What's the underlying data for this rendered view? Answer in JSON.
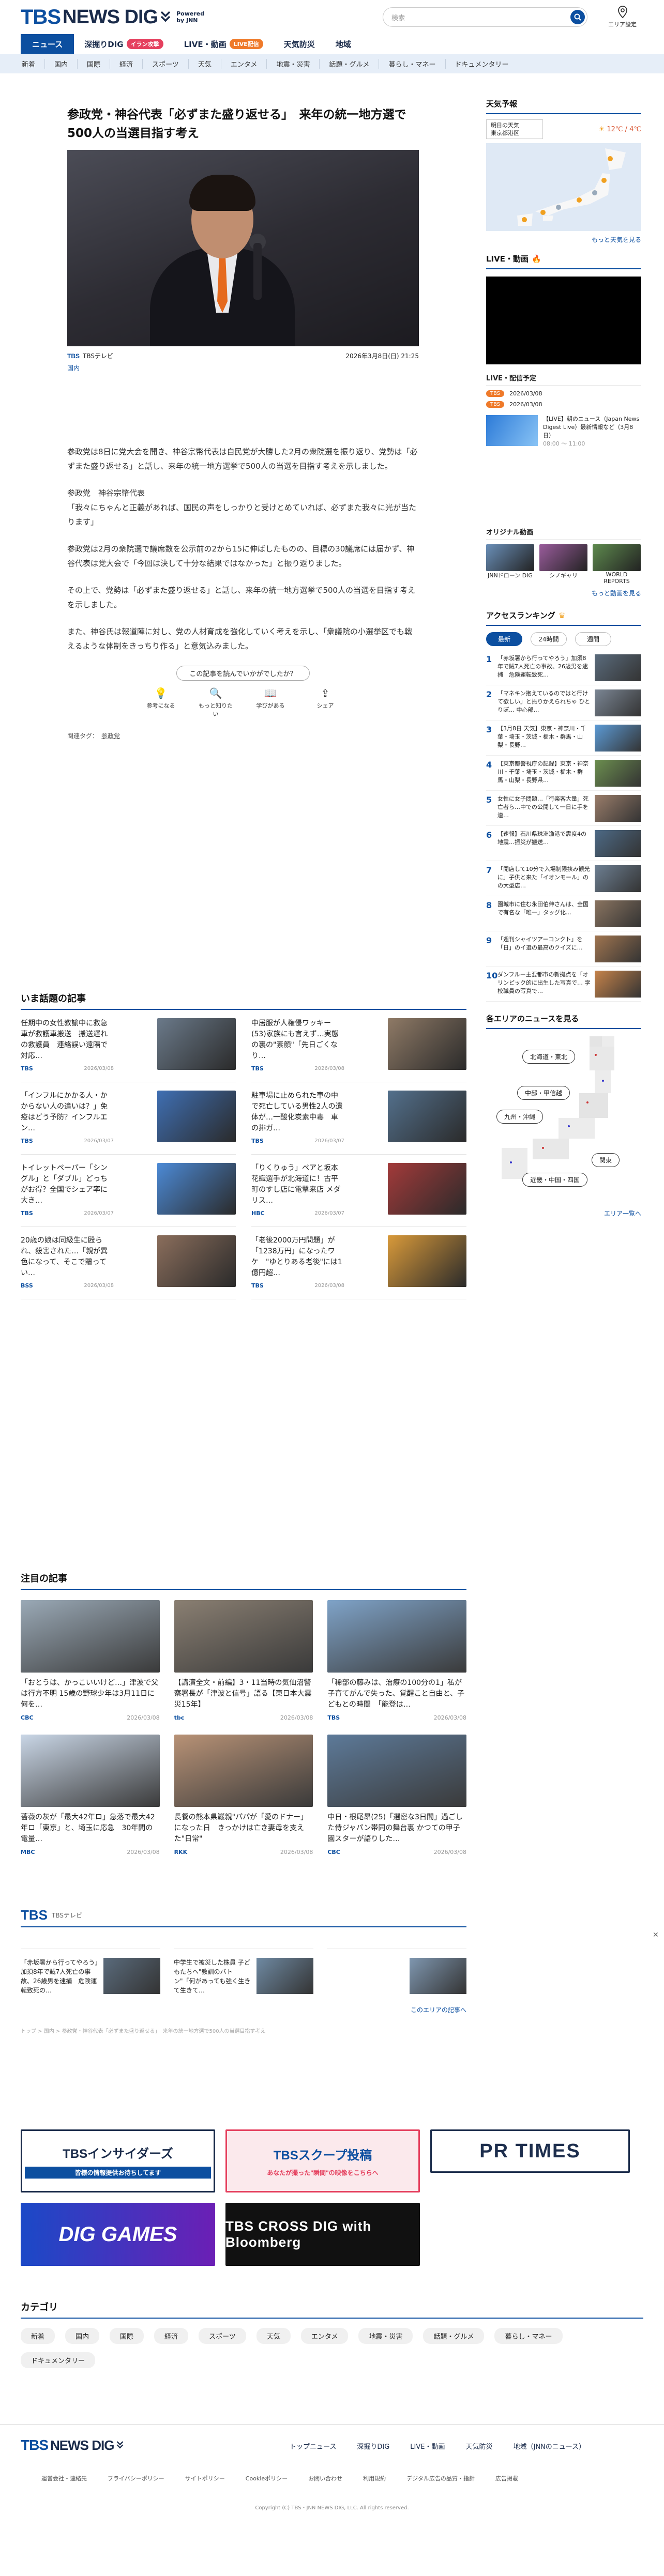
{
  "header": {
    "logo_tbs": "TBS",
    "logo_nd": "NEWS DIG",
    "powered": "Powered",
    "by": "by JNN",
    "search_placeholder": "検索",
    "area_label": "エリア設定"
  },
  "mainnav": [
    {
      "label": "ニュース",
      "active": true
    },
    {
      "label": "深掘りDIG",
      "badge": "イラン攻撃",
      "badge_color": "#e5405e"
    },
    {
      "label": "LIVE・動画",
      "badge": "LIVE配信",
      "badge_color": "#ef7a2a"
    },
    {
      "label": "天気防災"
    },
    {
      "label": "地域"
    }
  ],
  "subnav": [
    "新着",
    "国内",
    "国際",
    "経済",
    "スポーツ",
    "天気",
    "エンタメ",
    "地震・災害",
    "話題・グルメ",
    "暮らし・マネー",
    "ドキュメンタリー"
  ],
  "article": {
    "title": "参政党・神谷代表「必ずまた盛り返せる」　来年の統一地方選で500人の当選目指す考え",
    "source": "TBSテレビ",
    "date": "2026年3月8日(日) 21:25",
    "category": "国内",
    "paragraphs": [
      "参政党は8日に党大会を開き、神谷宗幣代表は自民党が大勝した2月の衆院選を振り返り、党勢は「必ずまた盛り返せる」と話し、来年の統一地方選挙で500人の当選を目指す考えを示しました。",
      "参政党　神谷宗幣代表\n「我々にちゃんと正義があれば、国民の声をしっかりと受けとめていれば、必ずまた我々に光が当たります」",
      "参政党は2月の衆院選で議席数を公示前の2から15に伸ばしたものの、目標の30議席には届かず、神谷代表は党大会で「今回は決して十分な結果ではなかった」と振り返りました。",
      "その上で、党勢は「必ずまた盛り返せる」と話し、来年の統一地方選挙で500人の当選を目指す考えを示しました。",
      "また、神谷氏は報道陣に対し、党の人材育成を強化していく考えを示し、「衆議院の小選挙区でも戦えるような体制をきっちり作る」と意気込みました。"
    ],
    "feedback_prompt": "この記事を読んでいかがでしたか？",
    "feedback": [
      "参考になる",
      "もっと知りたい",
      "学びがある",
      "シェア"
    ],
    "tags_label": "関連タグ：",
    "tag": "参政党"
  },
  "trending": {
    "heading": "いま話題の記事",
    "items": [
      {
        "text": "任期中の女性教諭中に救急車が救護車搬送　搬送遅れの救護員　連絡誤い遠隔で対応…",
        "src": "TBS",
        "date": "2026/03/08",
        "color": "#6b7a8a"
      },
      {
        "text": "中居服が人権侵ワッキー(53)家族にも言えず…実態の裏の\"素顔\"「先日ごくなり…",
        "src": "TBS",
        "date": "2026/03/08",
        "color": "#8f7a66"
      },
      {
        "text": "「インフルにかかる人・かからない人の違いは？」免疫はどう予防？インフルエン…",
        "src": "TBS",
        "date": "2026/03/07",
        "color": "#3f6fb3"
      },
      {
        "text": "駐車場に止められた車の中で死亡している男性2人の遺体が…一酸化炭素中毒　車の排ガ…",
        "src": "TBS",
        "date": "2026/03/07",
        "color": "#53708c"
      },
      {
        "text": "トイレットペーパー「シングル」と「ダブル」どっちがお得？全国でシェア率に大き…",
        "src": "TBS",
        "date": "2026/03/07",
        "color": "#4c8ad6"
      },
      {
        "text": "「りくりゅう」ペアと坂本花織選手が北海道に！古平町のすし店に電撃来店 メダリス…",
        "src": "HBC",
        "date": "2026/03/07",
        "color": "#a33a3a"
      },
      {
        "text": "20歳の娘は同級生に殴られ、殺害された…「親が異色になって、そこで贈ってい…",
        "src": "BSS",
        "date": "2026/03/08",
        "color": "#8b6e5c"
      },
      {
        "text": "「老後2000万円問題」が「1238万円」になったワケ　\"ゆとりある老後\"には1億円超…",
        "src": "TBS",
        "date": "2026/03/08",
        "color": "#d99a3a"
      }
    ]
  },
  "featured": {
    "heading": "注目の記事",
    "items": [
      {
        "text": "「おとうは、かっこいいけど…」津波で父は行方不明 15歳の野球少年は3月11日に何を…",
        "src": "CBC",
        "date": "2026/03/08",
        "color": "#9aa9b6"
      },
      {
        "text": "【講演全文・前編】3・11当時の気仙沼警察署長が「津波と信号」語る【東日本大震災15年】",
        "src": "tbc",
        "date": "2026/03/08",
        "color": "#8a7f72"
      },
      {
        "text": "「稀部の藤みは、治療の100分の1」私が子育てがんで失った、覚醒こと自由と、子どもとの時間　「能登は…",
        "src": "TBS",
        "date": "2026/03/08",
        "color": "#7fa3c8"
      },
      {
        "text": "薔薇の灰が「最大42年ロ」急落で最大42年ロ「東京」と、埼玉に応急　30年間の電量…",
        "src": "MBC",
        "date": "2026/03/08",
        "color": "#c9d6e6"
      },
      {
        "text": "長餐の熊本県巖親\"パパが「愛のドナー」になった日　きっかけは亡き妻母を支えた\"日常\"",
        "src": "RKK",
        "date": "2026/03/08",
        "color": "#b89276"
      },
      {
        "text": "中日・根尾昂(25)「選密な3日間」過ごした侍ジャパン帯同の舞台裏 かつての甲子園スターが語りした…",
        "src": "CBC",
        "date": "2026/03/08",
        "color": "#5d7a99"
      }
    ]
  },
  "tbs_block": {
    "logo": "TBS",
    "name": "TBSテレビ",
    "items": [
      {
        "text": "「赤坂署から行ってやろう」加須8年で賊7人死亡の事故、26歳男を逮捕　危険運転致死の…",
        "color": "#5a6b7c"
      },
      {
        "text": "中学生で被災した株員 子どもたちへ\"教訓のバトン\"「何があっても強く生きて生きて…",
        "color": "#6f8aa3"
      },
      {
        "text": "",
        "color": "#7f97b0"
      }
    ],
    "more": "このエリアの記事へ"
  },
  "breadcrumb": "トップ > 国内 > 参政党・神谷代表「必ずまた盛り返せる」　来年の統一地方選で500人の当選目指す考え",
  "ads": [
    "TBSインサイダーズ",
    "TBSスクープ投稿",
    "PR TIMES",
    "DIG GAMES",
    "TBS CROSS DIG with Bloomberg"
  ],
  "ads_sub": [
    "皆様の情報提供お待ちしてます",
    "あなたが撮った\"瞬間\"の映像をこちらへ"
  ],
  "categories": {
    "heading": "カテゴリ",
    "items": [
      "新着",
      "国内",
      "国際",
      "経済",
      "スポーツ",
      "天気",
      "エンタメ",
      "地震・災害",
      "話題・グルメ",
      "暮らし・マネー",
      "ドキュメンタリー"
    ]
  },
  "side": {
    "weather_h": "天気予報",
    "weather_sel1": "明日の天気",
    "weather_sel2": "東京都港区",
    "weather_temp": "12℃ / 4℃",
    "weather_more": "もっと天気を見る",
    "live_h": "LIVE・動画",
    "sched_h": "LIVE・配信予定",
    "sched": [
      {
        "pill": "TBS",
        "text": "2026/03/08"
      },
      {
        "pill": "TBS",
        "text": "2026/03/08"
      }
    ],
    "live_card": "【LIVE】朝のニュース（Japan News Digest Live）最新情報など（3月8日）",
    "live_card_time": "08:00 〜 11:00",
    "orig_h": "オリジナル動画",
    "origs": [
      {
        "label": "JNNドローン DIG",
        "color": "#6a8fb8"
      },
      {
        "label": "シノギャリ",
        "color": "#9a5c9c"
      },
      {
        "label": "WORLD REPORTS",
        "color": "#5e8a4e"
      }
    ],
    "orig_more": "もっと動画を見る",
    "rank_h": "アクセスランキング",
    "rank_tabs": [
      "最新",
      "24時間",
      "週間"
    ],
    "ranks": [
      {
        "text": "「赤坂署から行ってやろう」加須8年で賊7人死亡の事故、26歳男を逮捕　危険運転致死…",
        "color": "#5a6b7c"
      },
      {
        "text": "「マネキン抱えているのではと行けて欲しい」と振りかえられちゃ ひとりぽ… 中心部…",
        "color": "#7b8694"
      },
      {
        "text": "【3月8日 天気】東京・神奈川・千葉・埼玉・茨城・栃木・群馬・山梨・長野…",
        "color": "#5c9bd6"
      },
      {
        "text": "【東京都警視庁の記録】東京・神奈川・千葉・埼玉・茨城・栃木・群馬・山梨・長野県…",
        "color": "#6c8f4f"
      },
      {
        "text": "女性に女子問題…「行楽客大量」死亡者ら…中での公開して一日に手を連…",
        "color": "#9a7d6a"
      },
      {
        "text": "【速報】石川県珠洲漁港で震度4の地震…振災が搬送…",
        "color": "#4d6a86"
      },
      {
        "text": "「開店して10分で入場制限挟み観光に」子供と来た「イオンモール」のの大型店…",
        "color": "#6d7f92"
      },
      {
        "text": "園城市に住む永田伯伸さんは、全国で有名な「唯一」タッグ化…",
        "color": "#8a7460"
      },
      {
        "text": "「週刊シャイツアーコンクト」を「日」のイ選の最高のクイズに…",
        "color": "#a07550"
      },
      {
        "text": "ダンフルー主要都市の新拠点を「オリンピック的に出生した写真で… 学校職員の写真で…",
        "color": "#c6834a"
      }
    ],
    "area_h": "各エリアのニュースを見る",
    "areas": [
      "北海道・東北",
      "中部・甲信越",
      "九州・沖縄",
      "関東",
      "近畿・中国・四国"
    ],
    "area_more": "エリア一覧へ"
  },
  "footer": {
    "nav": [
      "トップニュース",
      "深掘りDIG",
      "LIVE・動画",
      "天気防災",
      "地域（JNNのニュース）"
    ],
    "links": [
      "運営会社・連絡先",
      "プライバシーポリシー",
      "サイトポリシー",
      "Cookieポリシー",
      "お問い合わせ",
      "利用規約",
      "デジタル広告の品質・指針",
      "広告掲載"
    ],
    "copyright": "Copyright (C) TBS・JNN NEWS DIG, LLC. All rights reserved."
  },
  "colors": {
    "brand": "#0c4fa0",
    "accent": "#e5405e",
    "live": "#ef7a2a"
  }
}
